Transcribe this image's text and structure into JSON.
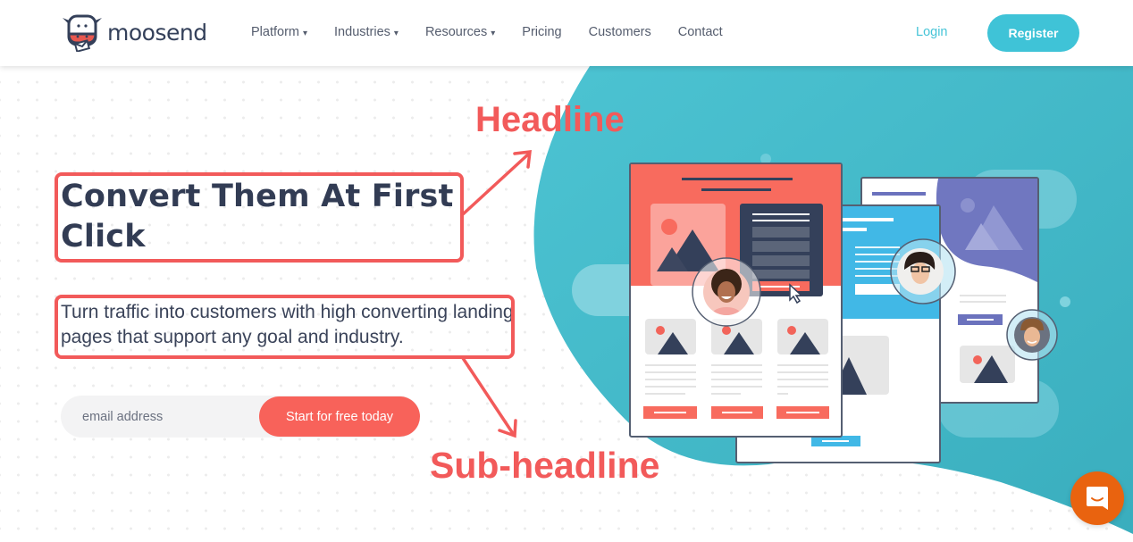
{
  "brand": {
    "name": "moosend"
  },
  "nav": {
    "items": [
      {
        "label": "Platform",
        "dropdown": true
      },
      {
        "label": "Industries",
        "dropdown": true
      },
      {
        "label": "Resources",
        "dropdown": true
      },
      {
        "label": "Pricing",
        "dropdown": false
      },
      {
        "label": "Customers",
        "dropdown": false
      },
      {
        "label": "Contact",
        "dropdown": false
      }
    ],
    "caret": "▾",
    "login_label": "Login",
    "register_label": "Register"
  },
  "hero": {
    "headline": "Convert Them At First Click",
    "subheadline": "Turn traffic into customers with high converting landing pages that support any goal and industry.",
    "email_placeholder": "email address",
    "cta_label": "Start for free today"
  },
  "annotations": {
    "headline_label": "Headline",
    "subheadline_label": "Sub-headline"
  },
  "colors": {
    "brand_teal": "#3fc3d7",
    "cta_coral": "#f8625a",
    "annotation_red": "#f25a5a",
    "text_dark": "#323c54",
    "chat_orange": "#e9630f"
  }
}
